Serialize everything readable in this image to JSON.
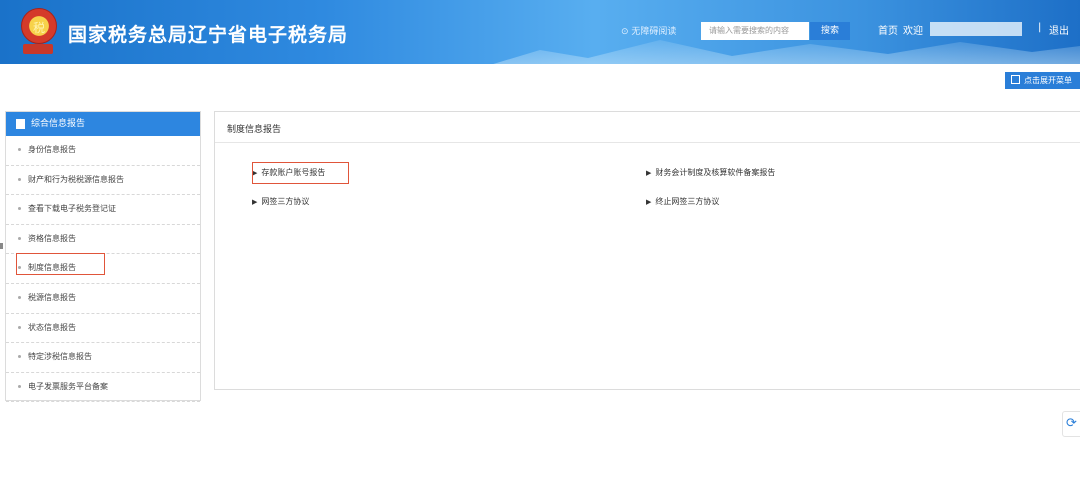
{
  "header": {
    "emblem_text": "税",
    "site_title": "国家税务总局辽宁省电子税务局",
    "accessibility_label": "⊙ 无障碍阅读",
    "search_placeholder": "请输入需要搜索的内容",
    "search_button": "搜索",
    "home": "首页",
    "welcome": "欢迎",
    "separator": "|",
    "logout": "退出"
  },
  "toolbar": {
    "expand_menu": "点击展开菜单"
  },
  "sidebar": {
    "header": "综合信息报告",
    "items": [
      {
        "label": "身份信息报告"
      },
      {
        "label": "财产和行为税税源信息报告"
      },
      {
        "label": "查看下载电子税务登记证"
      },
      {
        "label": "资格信息报告"
      },
      {
        "label": "制度信息报告"
      },
      {
        "label": "税源信息报告"
      },
      {
        "label": "状态信息报告"
      },
      {
        "label": "特定涉税信息报告"
      },
      {
        "label": "电子发票服务平台备案"
      }
    ]
  },
  "main": {
    "title": "制度信息报告",
    "links": [
      {
        "label": "存款账户账号报告"
      },
      {
        "label": "财务会计制度及核算软件备案报告"
      },
      {
        "label": "网签三方协议"
      },
      {
        "label": "终止网签三方协议"
      }
    ]
  },
  "colors": {
    "header_blue": "#2f8ae0",
    "accent": "#2a7ed8",
    "highlight_border": "#e0553a"
  }
}
